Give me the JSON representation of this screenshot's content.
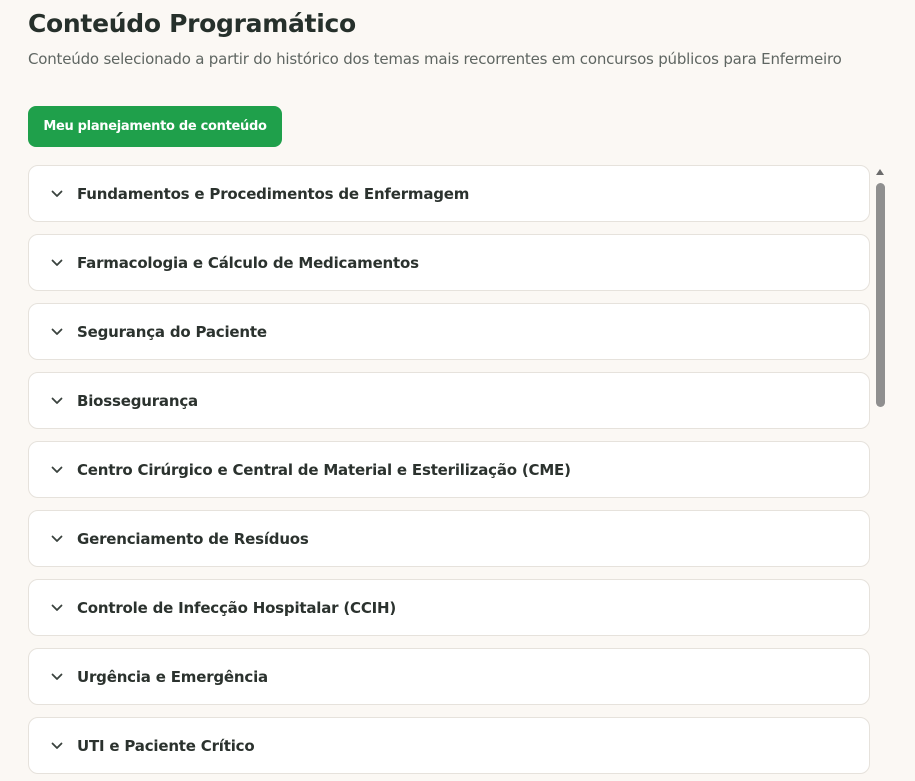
{
  "header": {
    "title": "Conteúdo Programático",
    "subtitle": "Conteúdo selecionado a partir do histórico dos temas mais recorrentes em concursos públicos para Enfermeiro"
  },
  "plan_button": {
    "label": "Meu planejamento de conteúdo",
    "color": "#1fa04b"
  },
  "topics": [
    {
      "label": "Fundamentos e Procedimentos de Enfermagem"
    },
    {
      "label": "Farmacologia e Cálculo de Medicamentos"
    },
    {
      "label": "Segurança do Paciente"
    },
    {
      "label": "Biossegurança"
    },
    {
      "label": "Centro Cirúrgico e Central de Material e Esterilização (CME)"
    },
    {
      "label": "Gerenciamento de Resíduos"
    },
    {
      "label": "Controle de Infecção Hospitalar (CCIH)"
    },
    {
      "label": "Urgência e Emergência"
    },
    {
      "label": "UTI e Paciente Crítico"
    }
  ],
  "icons": {
    "expand": "chevron-down-icon",
    "scroll_up": "arrow-up-icon"
  }
}
